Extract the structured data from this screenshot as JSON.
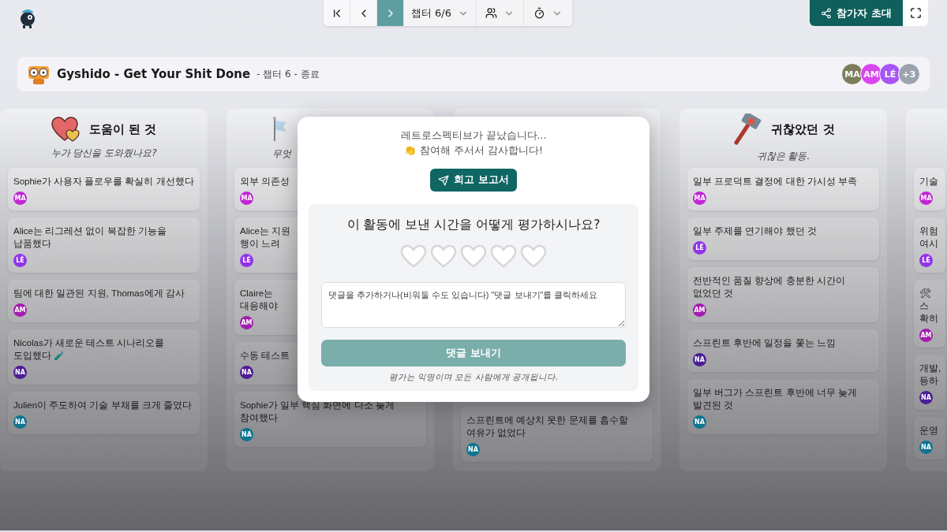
{
  "toolbar": {
    "nav": [
      {
        "kind": "first",
        "selected": false
      },
      {
        "kind": "prev",
        "selected": false
      },
      {
        "kind": "next",
        "selected": true
      }
    ],
    "chapter": "챕터 6/6",
    "invite": "참가자 초대"
  },
  "header": {
    "title": "Gyshido - Get Your Shit Done",
    "subtitle": "- 챕터 6 - 종료",
    "participants": [
      {
        "initials": "MA",
        "color": "#7d7c5c"
      },
      {
        "initials": "AM",
        "color": "#d946ef"
      },
      {
        "initials": "LÉ",
        "color": "#a855f7"
      }
    ],
    "more": "+3"
  },
  "columns": [
    {
      "kind": "heart",
      "title": "도움이 된 것",
      "subtitle": "누가 당신을 도와줬나요?",
      "cards": [
        {
          "text": "Sophie가 사용자 플로우를 확실히 개선했다",
          "author": {
            "initials": "MA",
            "color": "#c026d3"
          }
        },
        {
          "text": "Alice는 리그레션 없이 복잡한 기능을 납품했다",
          "author": {
            "initials": "LÉ",
            "color": "#9333ea"
          }
        },
        {
          "text": "팀에 대한 일관된 지원, Thomas에게 감사",
          "author": {
            "initials": "AM",
            "color": "#a21caf"
          }
        },
        {
          "text": "Nicolas가 새로운 테스트 시나리오를 도입했다 🧪",
          "author": {
            "initials": "NA",
            "color": "#4c1d95"
          }
        },
        {
          "text": "Julien이 주도하여 기술 부채를 크게 줄였다",
          "author": {
            "initials": "NA",
            "color": "#0e7490"
          }
        }
      ]
    },
    {
      "kind": "flag",
      "subtitle": "무엇",
      "cards": [
        {
          "text": "외부 의존성",
          "author": {
            "initials": "MA",
            "color": "#c026d3"
          }
        },
        {
          "text": "Alice는 지원\n행이 느려",
          "author": {
            "initials": "LÉ",
            "color": "#9333ea"
          }
        },
        {
          "text": "Claire는\n대응해야",
          "author": {
            "initials": "AM",
            "color": "#a21caf"
          }
        },
        {
          "text": "수동 테스트",
          "author": {
            "initials": "NA",
            "color": "#4c1d95"
          }
        },
        {
          "text": "Sophie가 일부 핵심 화면에 다소 늦게 참여했다",
          "author": {
            "initials": "NA",
            "color": "#0e7490"
          }
        }
      ]
    },
    {
      "cards": [
        {
          "text": "스프린트에 예상치 못한 문제를 흡수할 여유가 없었다",
          "author": {
            "initials": "NA",
            "color": "#0e7490"
          }
        }
      ]
    },
    {
      "kind": "hammer",
      "title": "귀찮았던 것",
      "subtitle": "귀찮은 활동.",
      "cards": [
        {
          "text": "일부 프로덕트 결정에 대한 가시성 부족",
          "author": {
            "initials": "MA",
            "color": "#c026d3"
          }
        },
        {
          "text": "일부 주제를 연기해야 했던 것",
          "author": {
            "initials": "LÉ",
            "color": "#9333ea"
          }
        },
        {
          "text": "전반적인 품질 향상에 충분한 시간이 없었던 것",
          "author": {
            "initials": "AM",
            "color": "#a21caf"
          }
        },
        {
          "text": "스프린트 후반에 일정을 쫓는 느낌",
          "author": {
            "initials": "NA",
            "color": "#4c1d95"
          }
        },
        {
          "text": "일부 버그가 스프린트 후반에 너무 늦게 발견된 것",
          "author": {
            "initials": "NA",
            "color": "#0e7490"
          }
        }
      ]
    },
    {
      "cards": [
        {
          "text": "기술",
          "author": {
            "initials": "MA",
            "color": "#c026d3"
          }
        },
        {
          "text": "위험\n여시",
          "author": {
            "initials": "LÉ",
            "color": "#9333ea"
          }
        },
        {
          "text": "🛠 스\n확히",
          "author": {
            "initials": "AM",
            "color": "#a21caf"
          }
        },
        {
          "text": "개발,\n등하",
          "author": {
            "initials": "NA",
            "color": "#4c1d95"
          }
        },
        {
          "text": "운영",
          "author": {
            "initials": "NA",
            "color": "#0e7490"
          }
        }
      ]
    }
  ],
  "modal": {
    "message": "레트로스펙티브가 끝났습니다...",
    "thanks": "👏 참여해 주서서 감사합니다!",
    "report_button": "회고 보고서",
    "rating": {
      "question": "이 활동에 보낸 시간을 어떻게 평가하시나요?",
      "stars": 0
    },
    "comment": {
      "placeholder": "댓글을 추가하거나(비워둘 수도 있습니다) \"댓글 보내기\"를 클릭하세요"
    },
    "send": {
      "label": "댓글 보내기",
      "disabled": true
    },
    "note": "평가는 익명이며 모든 사람에게 공개됩니다."
  }
}
